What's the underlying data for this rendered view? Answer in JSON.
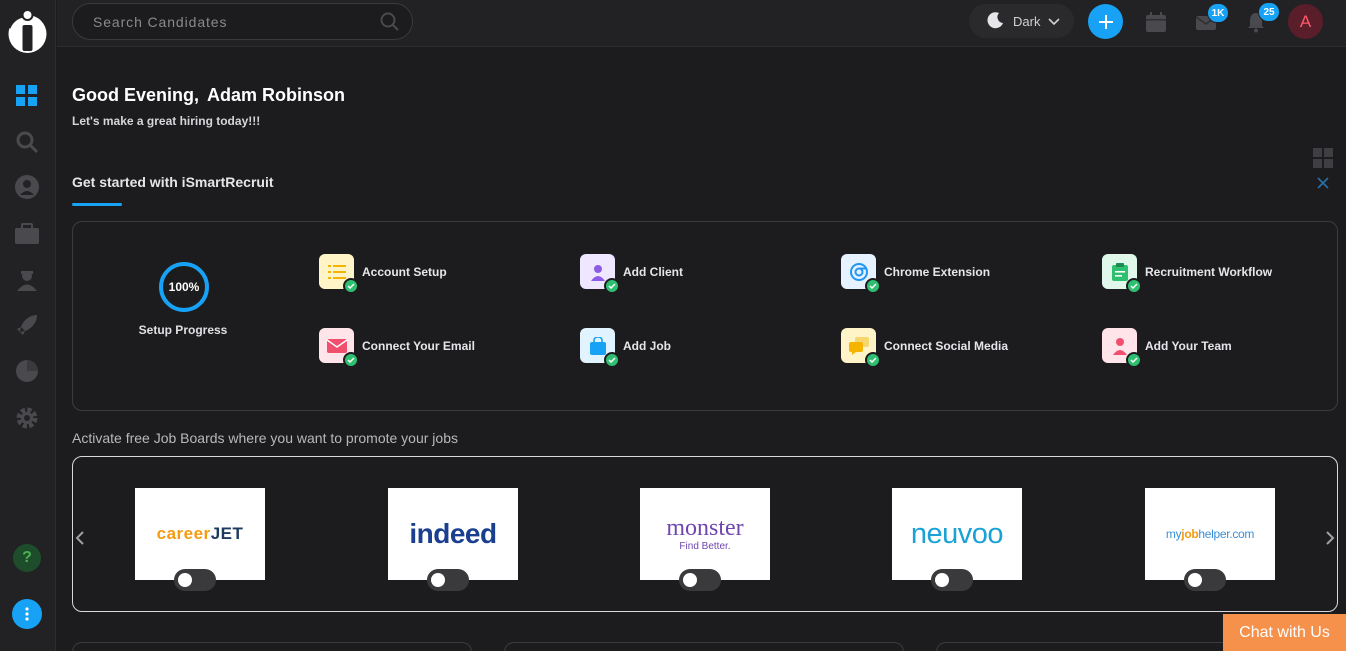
{
  "topbar": {
    "search_placeholder": "Search Candidates",
    "theme_label": "Dark",
    "mail_badge": "1K",
    "notification_badge": "25",
    "avatar_initial": "A"
  },
  "greeting": {
    "salutation": "Good Evening,",
    "name": "Adam Robinson",
    "subtitle": "Let's make a great hiring today!!!"
  },
  "getting_started": {
    "tab_label": "Get started with iSmartRecruit",
    "progress_value": "100%",
    "progress_label": "Setup Progress",
    "tasks": [
      {
        "label": "Account Setup",
        "done": true
      },
      {
        "label": "Add Client",
        "done": true
      },
      {
        "label": "Chrome Extension",
        "done": true
      },
      {
        "label": "Recruitment Workflow",
        "done": true
      },
      {
        "label": "Connect Your Email",
        "done": true
      },
      {
        "label": "Add Job",
        "done": true
      },
      {
        "label": "Connect Social Media",
        "done": true
      },
      {
        "label": "Add Your Team",
        "done": true
      }
    ]
  },
  "job_boards": {
    "title": "Activate free Job Boards where you want to promote your jobs",
    "boards": [
      {
        "name": "careerjet",
        "part1": "career",
        "part2": "JET",
        "enabled": false
      },
      {
        "name": "indeed",
        "text": "indeed",
        "enabled": false
      },
      {
        "name": "monster",
        "text": "monster",
        "tagline": "Find Better.",
        "enabled": false
      },
      {
        "name": "neuvoo",
        "text": "neuvoo",
        "enabled": false
      },
      {
        "name": "myjobhelper",
        "part1": "my",
        "part2": "job",
        "part3": "helper.com",
        "enabled": false
      }
    ]
  },
  "chat": {
    "label": "Chat with Us"
  },
  "colors": {
    "accent": "#17a2f5",
    "success": "#2fbf71",
    "chat": "#f5914a"
  }
}
